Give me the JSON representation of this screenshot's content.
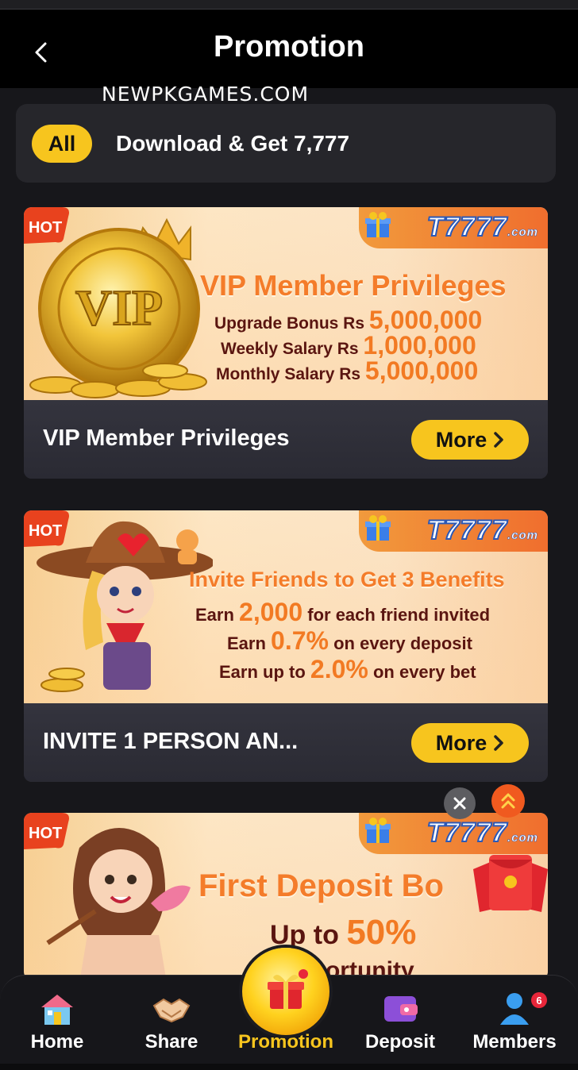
{
  "header": {
    "title": "Promotion",
    "watermark": "NEWPKGAMES.COM"
  },
  "tabs": [
    {
      "label": "All",
      "active": true
    },
    {
      "label": "Download & Get 7,777",
      "active": false
    }
  ],
  "brand": {
    "name": "T7777",
    "suffix": ".com"
  },
  "cards": [
    {
      "banner_title": "VIP Member Privileges",
      "lines": [
        {
          "label": "Upgrade Bonus Rs",
          "value": "5,000,000"
        },
        {
          "label": "Weekly Salary Rs",
          "value": "1,000,000"
        },
        {
          "label": "Monthly Salary Rs",
          "value": "5,000,000"
        }
      ],
      "badge": "VIP",
      "title": "VIP Member Privileges",
      "more": "More"
    },
    {
      "banner_title": "Invite Friends to Get 3 Benefits",
      "lines": [
        {
          "pre": "Earn",
          "value": "2,000",
          "post": "for each friend invited"
        },
        {
          "pre": "Earn",
          "value": "0.7%",
          "post": "on every deposit"
        },
        {
          "pre": "Earn up to",
          "value": "2.0%",
          "post": "on every bet"
        }
      ],
      "title": "INVITE 1 PERSON AN...",
      "more": "More"
    },
    {
      "banner_title": "First Deposit Bo",
      "line1_pre": "Up to",
      "line1_value": "50%",
      "line2": "U      Opportunity"
    }
  ],
  "hot_label": "HOT",
  "nav": [
    {
      "label": "Home",
      "icon": "home-icon"
    },
    {
      "label": "Share",
      "icon": "handshake-icon"
    },
    {
      "label": "Promotion",
      "icon": "gift-icon",
      "active": true
    },
    {
      "label": "Deposit",
      "icon": "wallet-icon"
    },
    {
      "label": "Members",
      "icon": "user-icon",
      "badge": "6"
    }
  ],
  "colors": {
    "accent": "#f7c51e",
    "background": "#17171b",
    "card": "#2b2b33",
    "orange": "#f27a23"
  }
}
